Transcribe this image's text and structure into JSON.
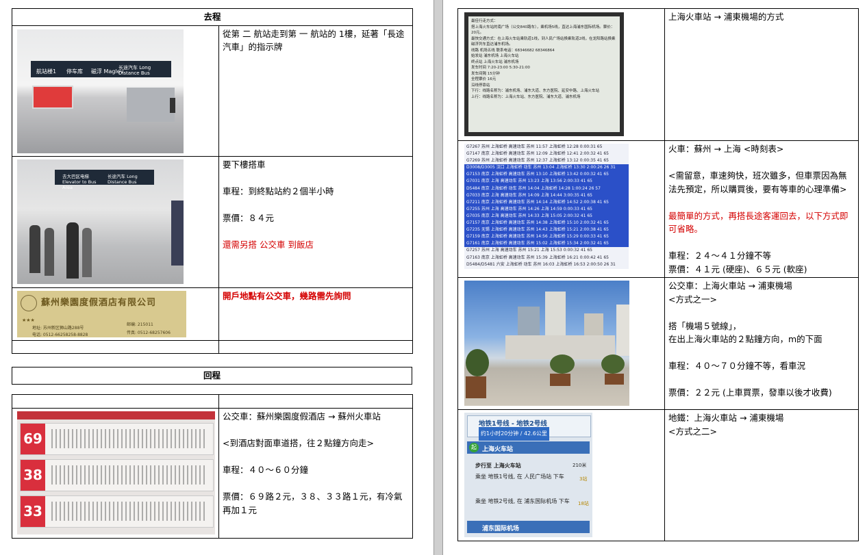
{
  "left": {
    "outbound": {
      "header": "去程",
      "rows": [
        {
          "text": [
            "從第 二 航站走到第 一 航站的 1樓，延著「長途汽車」的指示牌"
          ]
        },
        {
          "lines": [
            "要下樓搭車",
            "車程：到終點站約２個半小時",
            "票價：８４元"
          ],
          "note": "還需另搭  公交車   到飯店"
        },
        {
          "note": "開戶地點有公交車，幾路需先詢問",
          "card": {
            "name": "蘇州樂園度假酒店有限公司",
            "stars": "★★★",
            "addr": "地址: 苏州新区狮山路288号",
            "tel1": "电话: 0512-66258258-8828",
            "postcode": "邮编: 215011",
            "tel2": "传真: 0512-68257606"
          }
        }
      ]
    },
    "inbound": {
      "header": "回程",
      "rows": [
        {
          "lines": [
            "公交車：蘇州樂園度假酒店  →  蘇州火車站",
            "<到酒店對面車道搭，往２點鐘方向走>",
            "車程：４０～６０分鐘",
            "票價：６９路２元，３８、３３路１元，有冷氣再加１元"
          ],
          "buses": [
            "69",
            "38",
            "33"
          ]
        }
      ]
    },
    "signs": {
      "a1": "航站楼1",
      "a2": "停车库",
      "a3": "磁浮 Maglev",
      "a4": "长途汽车 Long Distance Bus",
      "b1": "去大巴区电梯 Elevator to Bus Area",
      "b2": "长途汽车 Long Distance Bus"
    }
  },
  "right": {
    "rows": [
      {
        "title": "上海火車站  →  浦東機場的方式",
        "screen": [
          "最佳行走方式：",
          "搭上海火车站的南广场（公交840路车），乘机场5线，直达上海浦东国际机场。票价：20元。",
          "最快交通方式：在上海火车站乘轨道1线，到人民广场站换乘轨道2线，在龙阳路站换乘磁浮列车直达浦东机场。",
          "",
          "线路 机场五线  联系电话：68346682 68346864",
          "",
          "始发站 浦东机场 上海火车站",
          "终点站 上海火车站 浦东机场",
          "发车时间 7:20-23:00 5:30-21:00",
          "",
          "发车间隔 15分钟",
          "全程票价 16元",
          "",
          "沿线停靠站",
          "下行：线路名称为：浦东机场、浦东大道、东方医院、延安中路、上海火车站",
          "上行：线路名称为：上海火车站、东方医院、浦东大道、浦东机场"
        ]
      },
      {
        "title": "火車：蘇州  →  上海    <時刻表>",
        "note1": "<需留意，車速夠快，班次雖多，但車票因為無法先預定，所以購買後，要有等車的心理準備>",
        "note2": "最簡單的方式，再搭長途客運回去，以下方式即可省略。",
        "lines": [
          "車程：２４～４１分鐘不等",
          "票價：４１元  (硬座)、６５元  (軟座)"
        ],
        "timetable": [
          "G7267 苏州 上海虹桥 高速动车 苏州 11:57 上海虹桥 12:28 0:00:31 65",
          "G7147 南京 上海虹桥 高速动车 苏州 12:09 上海虹桥 12:41 2:00:32 41 65",
          "G7269 苏州 上海虹桥 高速动车 苏州 12:37 上海虹桥 13:12 0:00:35 41 65",
          "D3008/D3005 汉口 上海虹桥 动车 苏州 13:04 上海虹桥 13:30 2:00:26 26 31",
          "G7153 南京 上海虹桥 高速动车 苏州 13:10 上海虹桥 13:42 0:00:32 41 65",
          "G7031 南京 上海 高速动车 苏州 13:23 上海 13:56 2:00:33 41 65",
          "D5484 南京 上海虹桥 动车 苏州 14:04 上海虹桥 14:28 1:00:24 26 57",
          "G7033 南京 上海 高速动车 苏州 14:09 上海 14:44 3:00:35 41 65",
          "G7211 南京 上海虹桥 高速动车 苏州 14:14 上海虹桥 14:52 2:00:38 41 65",
          "G7255 苏州 上海 高速动车 苏州 14:26 上海 14:59 0:00:33 41 65",
          "G7035 南京 上海 高速动车 苏州 14:33 上海 15:05 2:00:32 41 65",
          "G7157 南京 上海虹桥 高速动车 苏州 14:38 上海虹桥 15:10 2:00:32 41 65",
          "G7235 无锡 上海虹桥 高速动车 苏州 14:43 上海虹桥 15:21 2:00:38 41 65",
          "G7159 南京 上海虹桥 高速动车 苏州 14:56 上海虹桥 15:29 0:00:33 41 65",
          "G7161 南京 上海虹桥 高速动车 苏州 15:02 上海虹桥 15:34 2:00:32 41 65",
          "G7257 苏州 上海 高速动车 苏州 15:21 上海 15:53 0:00:32 41 65",
          "G7163 南京 上海虹桥 高速动车 苏州 15:39 上海虹桥 16:21 0:00:42 41 65",
          "D5484/D5481 六安 上海虹桥 动车 苏州 16:03 上海虹桥 16:53 2:00:50 26 31"
        ]
      },
      {
        "lines": [
          "公交車：上海火車站  →  浦東機場",
          "<方式之一>",
          "",
          "搭「機場５號線」，",
          "在出上海火車站的２點鐘方向，m的下面",
          "",
          "車程：４０～７０分鐘不等，看車況",
          "",
          "票價：２２元  (上車買票，發車以後才收費)"
        ]
      },
      {
        "lines": [
          "地鐵：上海火車站  →  浦東機場",
          "<方式之二>"
        ],
        "metro": {
          "title": "地铁1号线 - 地铁2号线",
          "sub": "约1小时20分钟 / 42.6公里",
          "start_badge": "起",
          "start": "上海火车站",
          "walk": "步行至 上海火车站",
          "walk_dist": "210米",
          "step1": "乘坐 地铁1号线, 在 人民广场站 下车",
          "step1_n": "3站",
          "step2": "乘坐 地铁2号线, 在 浦东国际机场 下车",
          "step2_n": "18站",
          "end": "浦东国际机场"
        }
      }
    ]
  }
}
